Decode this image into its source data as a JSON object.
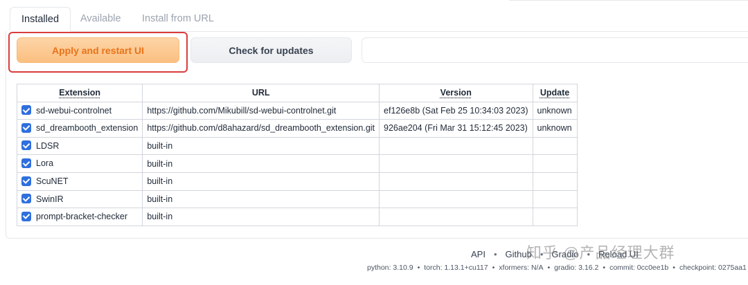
{
  "tabs": [
    "Installed",
    "Available",
    "Install from URL"
  ],
  "buttons": {
    "apply": "Apply and restart UI",
    "check": "Check for updates"
  },
  "table": {
    "headers": [
      "Extension",
      "URL",
      "Version",
      "Update"
    ],
    "rows": [
      {
        "name": "sd-webui-controlnet",
        "url": "https://github.com/Mikubill/sd-webui-controlnet.git",
        "version": "ef126e8b (Sat Feb 25 10:34:03 2023)",
        "update": "unknown",
        "checked": true
      },
      {
        "name": "sd_dreambooth_extension",
        "url": "https://github.com/d8ahazard/sd_dreambooth_extension.git",
        "version": "926ae204 (Fri Mar 31 15:12:45 2023)",
        "update": "unknown",
        "checked": true
      },
      {
        "name": "LDSR",
        "url": "built-in",
        "version": "",
        "update": "",
        "checked": true
      },
      {
        "name": "Lora",
        "url": "built-in",
        "version": "",
        "update": "",
        "checked": true
      },
      {
        "name": "ScuNET",
        "url": "built-in",
        "version": "",
        "update": "",
        "checked": true
      },
      {
        "name": "SwinIR",
        "url": "built-in",
        "version": "",
        "update": "",
        "checked": true
      },
      {
        "name": "prompt-bracket-checker",
        "url": "built-in",
        "version": "",
        "update": "",
        "checked": true
      }
    ]
  },
  "footer": {
    "links": [
      "API",
      "Github",
      "Gradio",
      "Reload UI"
    ],
    "info": [
      "python: 3.10.9",
      "torch: 1.13.1+cu117",
      "xformers: N/A",
      "gradio: 3.16.2",
      "commit: 0cc0ee1b",
      "checkpoint: 0275aa1"
    ]
  },
  "watermark": "知乎 @产品经理大群",
  "colors": {
    "accent": "#2f6fde",
    "apply_text": "#e8731a",
    "highlight": "#d93c3c"
  }
}
